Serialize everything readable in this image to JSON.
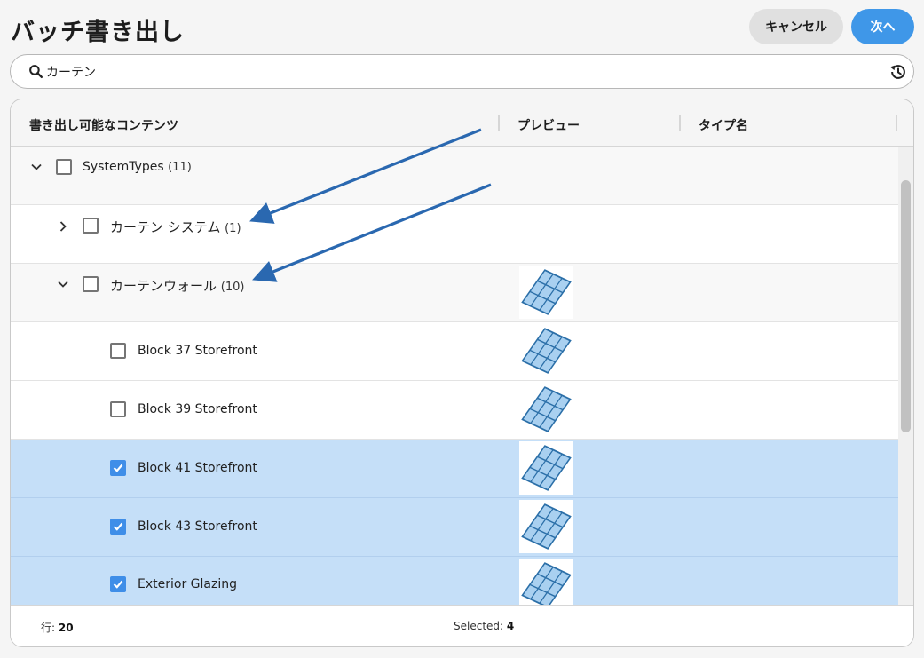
{
  "header": {
    "title": "バッチ書き出し",
    "cancel_label": "キャンセル",
    "next_label": "次へ"
  },
  "search": {
    "value": "カーテン",
    "placeholder": ""
  },
  "table": {
    "columns": [
      "書き出し可能なコンテンツ",
      "プレビュー",
      "タイプ名"
    ],
    "rows": [
      {
        "label": "SystemTypes",
        "count": "(11)",
        "expanded": true,
        "checked": false,
        "level": 0
      },
      {
        "label": "カーテン システム",
        "count": "(1)",
        "expanded": false,
        "checked": false,
        "level": 1
      },
      {
        "label": "カーテンウォール",
        "count": "(10)",
        "expanded": true,
        "checked": false,
        "level": 1,
        "preview": "curtain-wall-icon"
      },
      {
        "label": "Block 37 Storefront",
        "checked": false,
        "level": 2,
        "preview": "curtain-wall-icon"
      },
      {
        "label": "Block 39 Storefront",
        "checked": false,
        "level": 2,
        "preview": "curtain-wall-icon"
      },
      {
        "label": "Block 41 Storefront",
        "checked": true,
        "level": 2,
        "preview": "curtain-wall-icon"
      },
      {
        "label": "Block 43 Storefront",
        "checked": true,
        "level": 2,
        "preview": "curtain-wall-icon"
      },
      {
        "label": "Exterior Glazing",
        "checked": true,
        "level": 2,
        "preview": "curtain-wall-icon"
      }
    ]
  },
  "footer": {
    "rows_label": "行:",
    "rows_value": "20",
    "selected_label": "Selected:",
    "selected_value": "4"
  },
  "colors": {
    "accent": "#3f97e8",
    "selected_row": "#c5dff8",
    "annotation_arrow": "#2a68b0"
  }
}
